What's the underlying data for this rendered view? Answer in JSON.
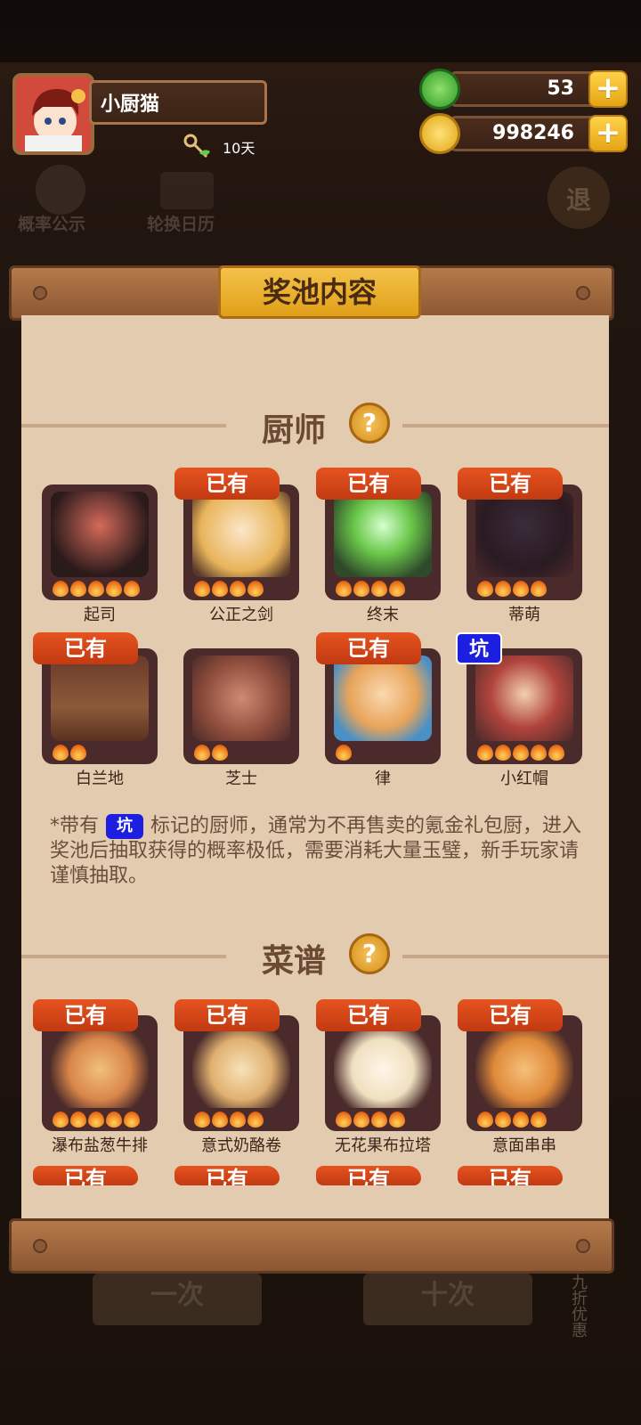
{
  "profile": {
    "name": "小厨猫",
    "days": "10天"
  },
  "currency": [
    {
      "icon": "jade-icon",
      "value": "53"
    },
    {
      "icon": "coin-icon",
      "value": "998246"
    }
  ],
  "background": {
    "left_button": "概率公示",
    "calendar_button": "轮换日历",
    "exit_button": "退"
  },
  "panel": {
    "title": "奖池内容"
  },
  "chef_section": {
    "title": "厨师",
    "items": [
      {
        "name": "起司",
        "badge": "",
        "flames": 5,
        "color": "#c24b4b"
      },
      {
        "name": "公正之剑",
        "badge": "已有",
        "flames": 4,
        "color": "#f3d9a0"
      },
      {
        "name": "终末",
        "badge": "已有",
        "flames": 4,
        "color": "#78c34c"
      },
      {
        "name": "蒂萌",
        "badge": "已有",
        "flames": 4,
        "color": "#3a2c3a"
      },
      {
        "name": "白兰地",
        "badge": "已有",
        "flames": 2,
        "color": "#8c5a3a"
      },
      {
        "name": "芝士",
        "badge": "",
        "flames": 2,
        "color": "#c98a70"
      },
      {
        "name": "律",
        "badge": "已有",
        "flames": 1,
        "color": "#f1c48a"
      },
      {
        "name": "小红帽",
        "badge": "坑",
        "flames": 5,
        "color": "#b0443c"
      }
    ]
  },
  "note": {
    "prefix": "*带有",
    "pit_label": "坑",
    "suffix": "标记的厨师，通常为不再售卖的氪金礼包厨，进入奖池后抽取获得的概率极低，需要消耗大量玉璧，新手玩家请谨慎抽取。"
  },
  "recipe_section": {
    "title": "菜谱",
    "items": [
      {
        "name": "瀑布盐葱牛排",
        "badge": "已有",
        "flames": 5,
        "color": "#d9864a"
      },
      {
        "name": "意式奶酪卷",
        "badge": "已有",
        "flames": 4,
        "color": "#e0b070"
      },
      {
        "name": "无花果布拉塔",
        "badge": "已有",
        "flames": 4,
        "color": "#f0e0c0"
      },
      {
        "name": "意面串串",
        "badge": "已有",
        "flames": 4,
        "color": "#e08a3a"
      }
    ],
    "next_row_badges": [
      "已有",
      "已有",
      "已有",
      "已有"
    ]
  },
  "footer": {
    "btn1": "一次",
    "btn2": "十次",
    "side": "九折优惠"
  }
}
